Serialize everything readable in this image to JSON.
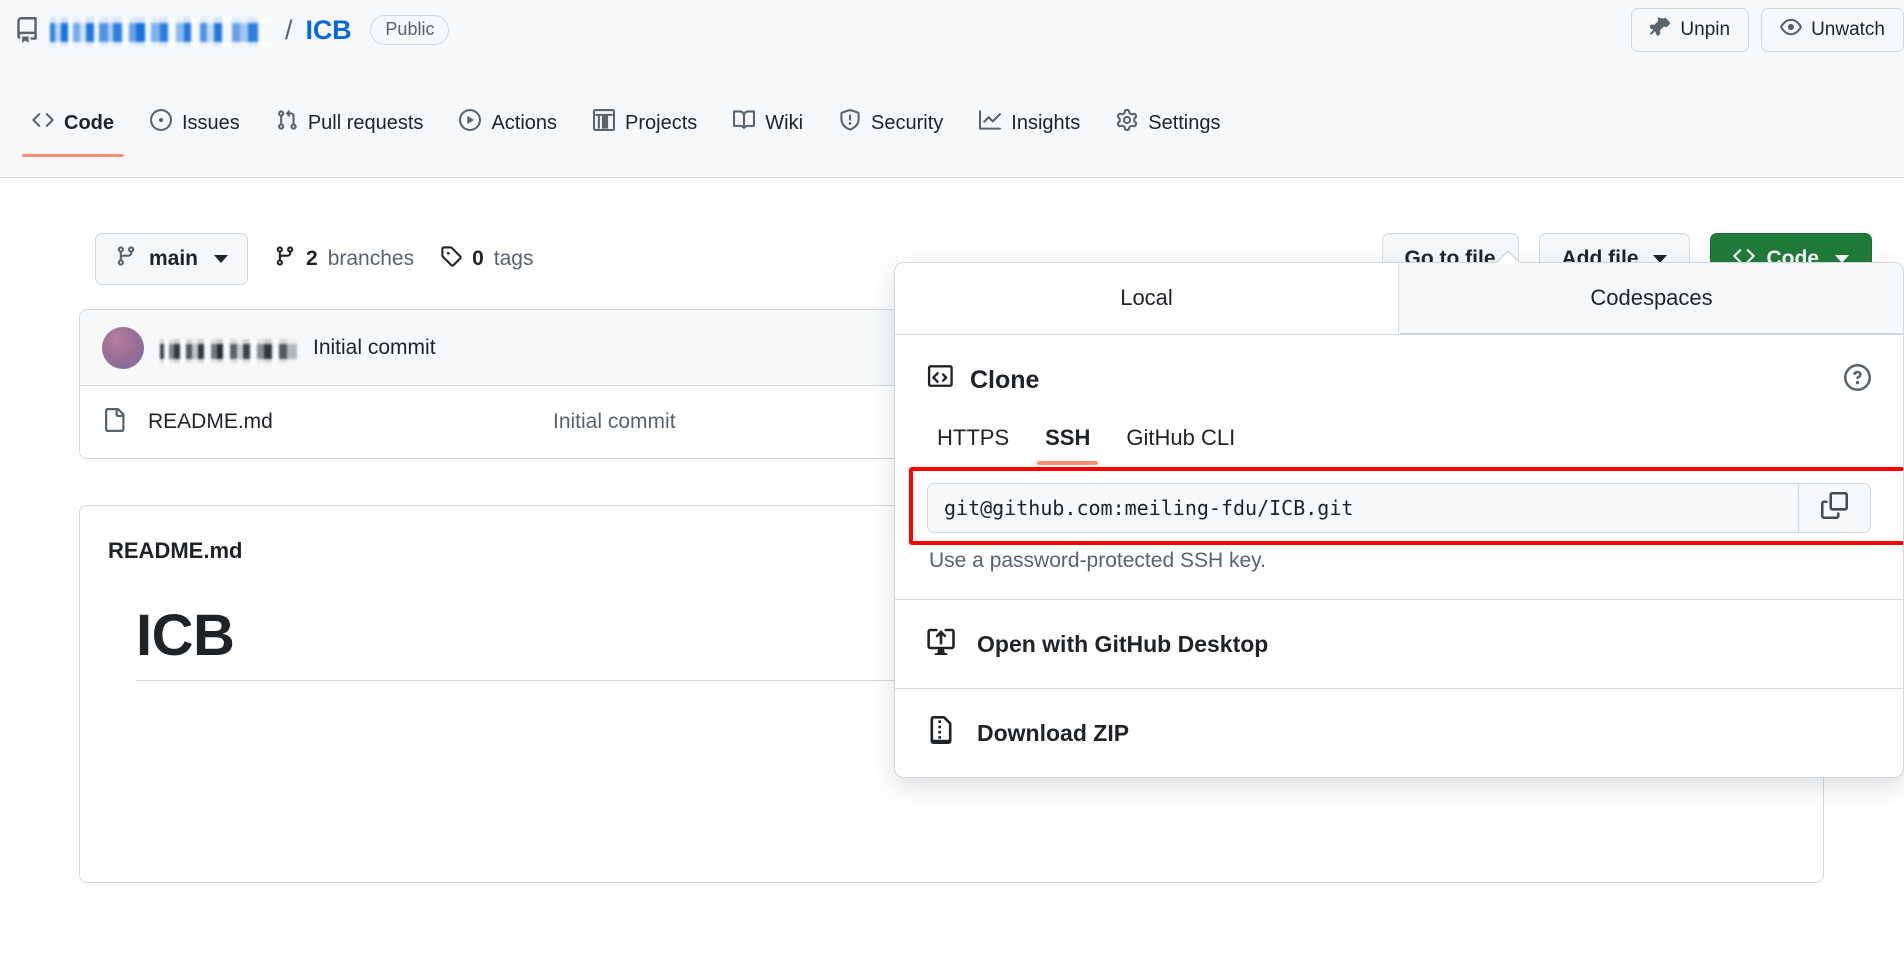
{
  "header": {
    "repo_icon": "repo-icon",
    "owner_name": "",
    "separator": "/",
    "repo_name": "ICB",
    "visibility": "Public",
    "actions": [
      {
        "label": "Unpin",
        "icon": "unpin-icon"
      },
      {
        "label": "Unwatch",
        "icon": "eye-icon"
      }
    ]
  },
  "nav": {
    "items": [
      {
        "label": "Code",
        "icon": "code-icon",
        "active": true
      },
      {
        "label": "Issues",
        "icon": "issue-opened-icon",
        "active": false
      },
      {
        "label": "Pull requests",
        "icon": "git-pull-request-icon",
        "active": false
      },
      {
        "label": "Actions",
        "icon": "play-icon",
        "active": false
      },
      {
        "label": "Projects",
        "icon": "table-icon",
        "active": false
      },
      {
        "label": "Wiki",
        "icon": "book-icon",
        "active": false
      },
      {
        "label": "Security",
        "icon": "shield-icon",
        "active": false
      },
      {
        "label": "Insights",
        "icon": "graph-icon",
        "active": false
      },
      {
        "label": "Settings",
        "icon": "gear-icon",
        "active": false
      }
    ]
  },
  "toolbar": {
    "branch": "main",
    "branches_count": "2",
    "branches_label": "branches",
    "tags_count": "0",
    "tags_label": "tags",
    "go_to_file": "Go to file",
    "add_file": "Add file",
    "code_button": "Code"
  },
  "files": {
    "commit_author": "",
    "commit_message": "Initial commit",
    "rows": [
      {
        "name": "README.md",
        "icon": "file-icon",
        "commit": "Initial commit"
      }
    ]
  },
  "readme": {
    "filename": "README.md",
    "heading": "ICB"
  },
  "code_panel": {
    "tabs": [
      {
        "label": "Local",
        "active": true
      },
      {
        "label": "Codespaces",
        "active": false
      }
    ],
    "clone_title": "Clone",
    "help_icon": "question-icon",
    "protocols": [
      {
        "label": "HTTPS",
        "active": false
      },
      {
        "label": "SSH",
        "active": true
      },
      {
        "label": "GitHub CLI",
        "active": false
      }
    ],
    "clone_url": "git@github.com:meiling-fdu/ICB.git",
    "copy_icon": "copy-icon",
    "note": "Use a password-protected SSH key.",
    "items": [
      {
        "label": "Open with GitHub Desktop",
        "icon": "desktop-download-icon"
      },
      {
        "label": "Download ZIP",
        "icon": "file-zip-icon"
      }
    ]
  },
  "colors": {
    "accent_green": "#1f7b38",
    "link_blue": "#0969da",
    "highlight_red": "#ff0000",
    "tab_underline": "#fd8c73"
  }
}
